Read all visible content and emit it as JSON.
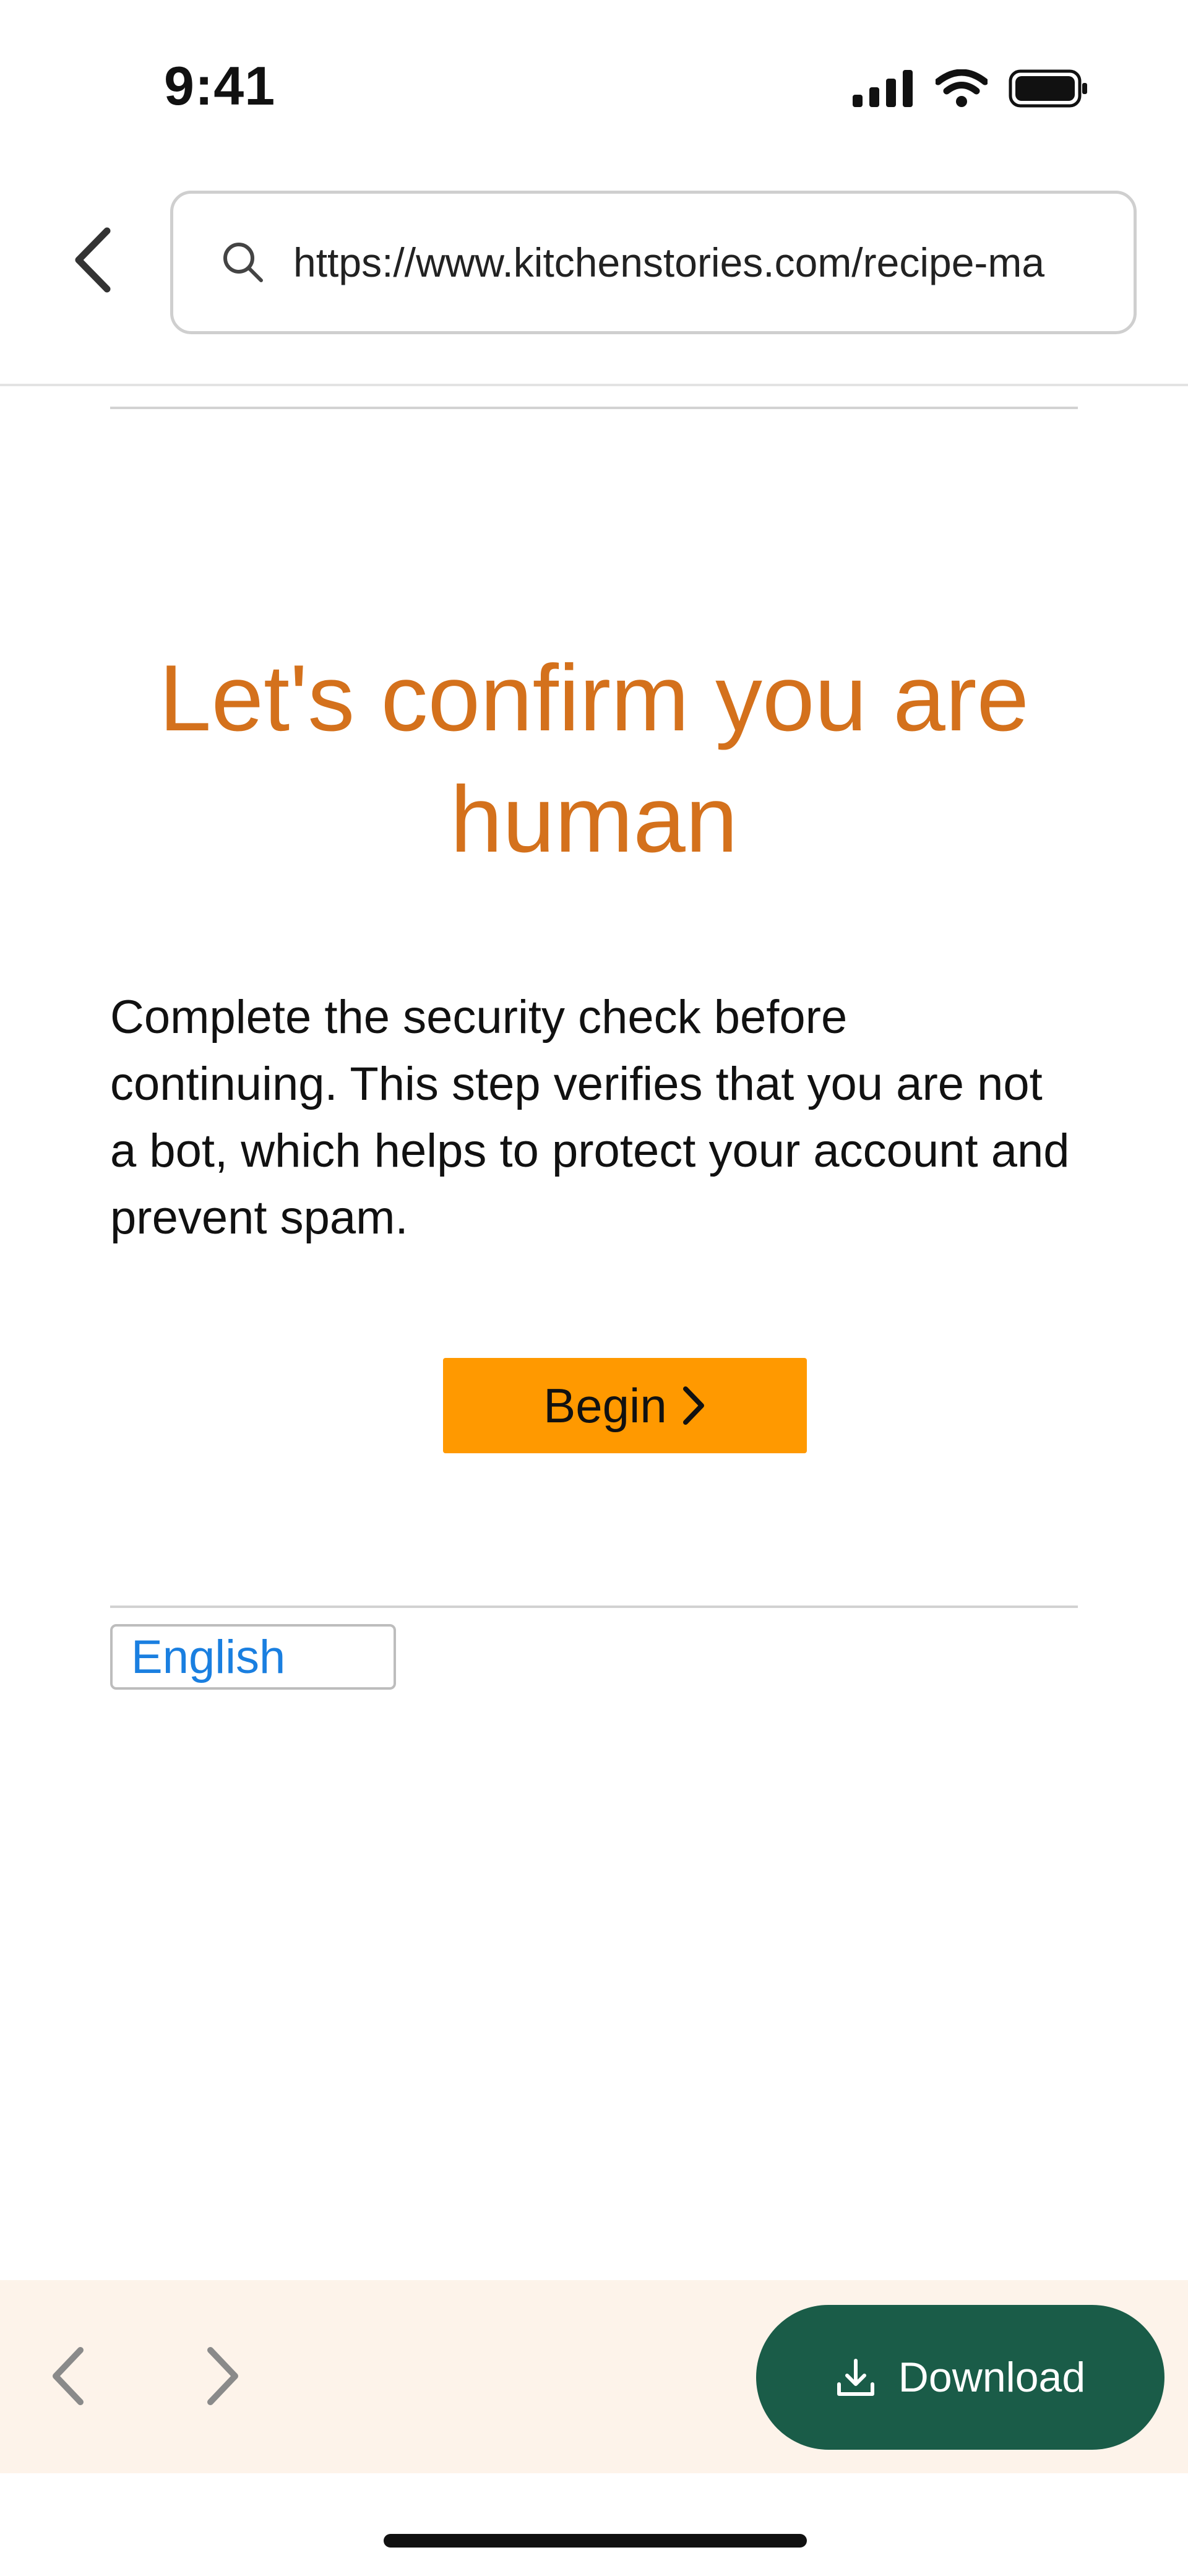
{
  "status_bar": {
    "time": "9:41"
  },
  "browser": {
    "url": "https://www.kitchenstories.com/recipe-ma"
  },
  "content": {
    "title": "Let's confirm you are human",
    "description": "Complete the security check before continuing. This step verifies that you are not a bot, which helps to protect your account and prevent spam.",
    "begin_label": "Begin",
    "language": "English"
  },
  "toolbar": {
    "download_label": "Download"
  },
  "colors": {
    "title": "#d4711c",
    "begin_button": "#ff9900",
    "language_link": "#1a7fe0",
    "download_button": "#1a5c48",
    "toolbar_bg": "#fdf3ea"
  },
  "icons": [
    "signal-icon",
    "wifi-icon",
    "battery-icon",
    "back-icon",
    "search-icon",
    "chevron-right-icon",
    "forward-icon",
    "download-icon"
  ]
}
